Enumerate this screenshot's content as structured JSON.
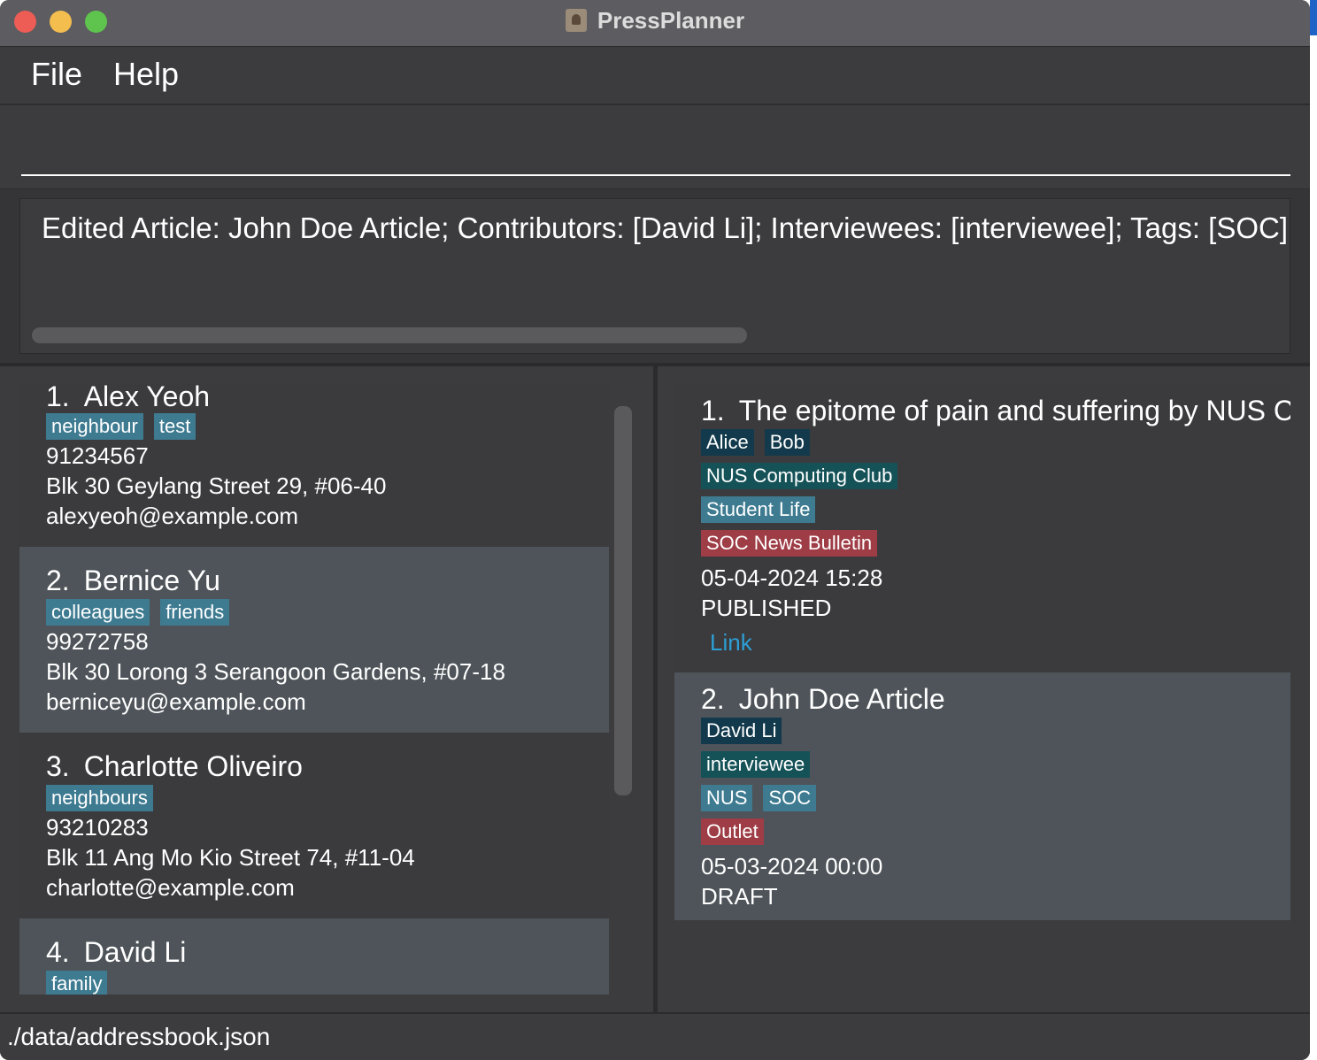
{
  "window": {
    "title": "PressPlanner"
  },
  "menu": {
    "file": "File",
    "help": "Help"
  },
  "command": {
    "value": ""
  },
  "result": {
    "text": "Edited Article: John Doe Article; Contributors: [David Li]; Interviewees: [interviewee]; Tags: [SOC][NUS]"
  },
  "persons": [
    {
      "index": "1.",
      "name": "Alex Yeoh",
      "tags": [
        "neighbour",
        "test"
      ],
      "phone": "91234567",
      "address": "Blk 30 Geylang Street 29, #06-40",
      "email": "alexyeoh@example.com"
    },
    {
      "index": "2.",
      "name": "Bernice Yu",
      "tags": [
        "colleagues",
        "friends"
      ],
      "phone": "99272758",
      "address": "Blk 30 Lorong 3 Serangoon Gardens, #07-18",
      "email": "berniceyu@example.com"
    },
    {
      "index": "3.",
      "name": "Charlotte Oliveiro",
      "tags": [
        "neighbours"
      ],
      "phone": "93210283",
      "address": "Blk 11 Ang Mo Kio Street 74, #11-04",
      "email": "charlotte@example.com"
    },
    {
      "index": "4.",
      "name": "David Li",
      "tags": [
        "family"
      ]
    }
  ],
  "articles": [
    {
      "index": "1.",
      "title": "The epitome of pain and suffering by NUS C...",
      "contributors": [
        "Alice",
        "Bob"
      ],
      "interviewees": [
        "NUS Computing Club"
      ],
      "tags": [
        "Student Life"
      ],
      "outlets": [
        "SOC News Bulletin"
      ],
      "date": "05-04-2024 15:28",
      "status": "PUBLISHED",
      "link": "Link"
    },
    {
      "index": "2.",
      "title": "John Doe Article",
      "contributors": [
        "David Li"
      ],
      "interviewees": [
        "interviewee"
      ],
      "tags": [
        "NUS",
        "SOC"
      ],
      "outlets": [
        "Outlet"
      ],
      "date": "05-03-2024 00:00",
      "status": "DRAFT"
    }
  ],
  "status": {
    "path": "./data/addressbook.json"
  },
  "colors": {
    "tag_blue": "#3e7b91",
    "tag_navy": "#123a4c",
    "tag_teal": "#155258",
    "tag_red": "#9e3d46",
    "link": "#2d9fd6"
  }
}
